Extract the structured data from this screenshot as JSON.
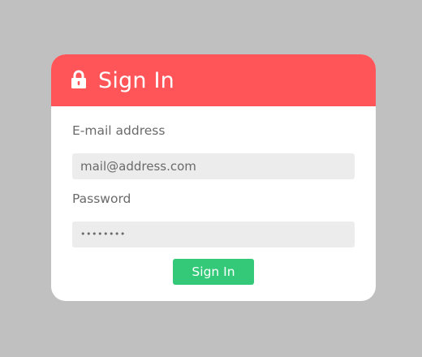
{
  "header": {
    "title": "Sign In",
    "icon": "lock-icon",
    "color": "#ff5558"
  },
  "form": {
    "email": {
      "label": "E-mail address",
      "value": "mail@address.com"
    },
    "password": {
      "label": "Password",
      "value": "••••••••"
    },
    "submit_label": "Sign In",
    "submit_color": "#33c979"
  },
  "background_color": "#c0c0c0"
}
